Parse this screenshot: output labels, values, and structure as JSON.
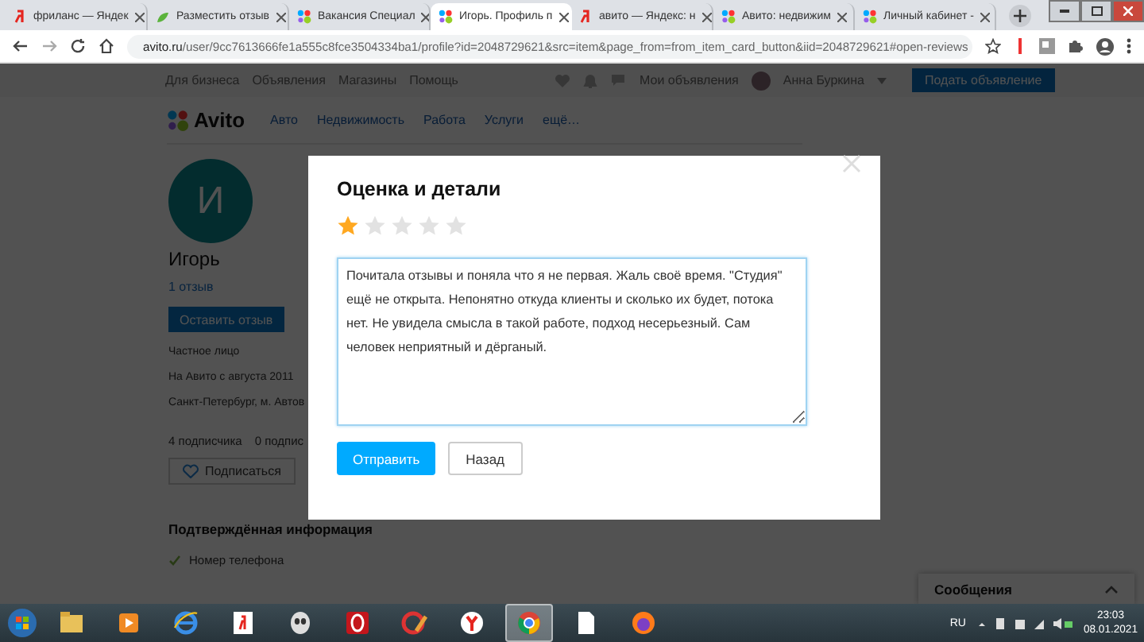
{
  "browser": {
    "tabs": [
      {
        "title": "фриланс — Яндек",
        "kind": "yandex",
        "selected": false
      },
      {
        "title": "Разместить отзыв",
        "kind": "leaf",
        "selected": false
      },
      {
        "title": "Вакансия Специал",
        "kind": "avito",
        "selected": false
      },
      {
        "title": "Игорь. Профиль п",
        "kind": "avito",
        "selected": true
      },
      {
        "title": "авито — Яндекс: н",
        "kind": "yandex",
        "selected": false
      },
      {
        "title": "Авито: недвижим",
        "kind": "avito",
        "selected": false
      },
      {
        "title": "Личный кабинет -",
        "kind": "avito",
        "selected": false
      }
    ],
    "url_host": "avito.ru",
    "url_path": "/user/9cc7613666fe1a555c8fce3504334ba1/profile?id=2048729621&src=item&page_from=from_item_card_button&iid=2048729621#open-reviews"
  },
  "site_nav": {
    "links": [
      "Для бизнеса",
      "Объявления",
      "Магазины",
      "Помощь"
    ],
    "my_ads": "Мои объявления",
    "user": "Анна Буркина",
    "post_button": "Подать объявление"
  },
  "header": {
    "logo": "Avito",
    "categories": [
      "Авто",
      "Недвижимость",
      "Работа",
      "Услуги",
      "ещё…"
    ]
  },
  "profile": {
    "avatar_letter": "И",
    "name": "Игорь",
    "reviews_link": "1 отзыв",
    "leave_review": "Оставить отзыв",
    "info": [
      "Частное лицо",
      "На Авито с августа 2011",
      "Санкт-Петербург, м. Автов"
    ],
    "subscribers": "4 подписчика",
    "subscriptions": "0 подпис",
    "subscribe": "Подписаться",
    "confirmed_heading": "Подтверждённая информация",
    "confirmed": [
      "Номер телефона"
    ]
  },
  "modal": {
    "title": "Оценка и детали",
    "stars": 1,
    "review": "Почитала отзывы и поняла что я не первая. Жаль своё время. \"Студия\" ещё не открыта. Непонятно откуда клиенты и сколько их будет, потока нет. Не увидела смысла в такой работе, подход несерьезный. Сам человек неприятный и дёрганый.",
    "submit": "Отправить",
    "back": "Назад"
  },
  "messages": {
    "title": "Сообщения"
  },
  "taskbar": {
    "apps": [
      {
        "kind": "folder",
        "selected": false
      },
      {
        "kind": "player",
        "selected": false
      },
      {
        "kind": "ie",
        "selected": false
      },
      {
        "kind": "yandex",
        "selected": false
      },
      {
        "kind": "alien",
        "selected": false
      },
      {
        "kind": "opera",
        "selected": false
      },
      {
        "kind": "ccleaner",
        "selected": false
      },
      {
        "kind": "ybrowser",
        "selected": false
      },
      {
        "kind": "chrome",
        "selected": true
      },
      {
        "kind": "file",
        "selected": false
      },
      {
        "kind": "firefox",
        "selected": false
      }
    ],
    "lang": "RU",
    "time": "23:03",
    "date": "08.01.2021"
  }
}
